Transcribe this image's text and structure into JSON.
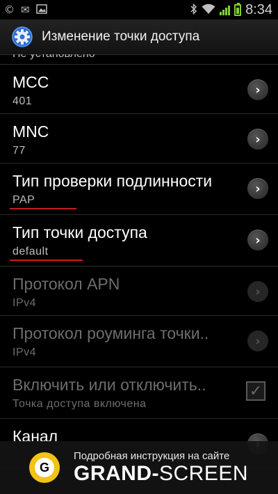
{
  "status_bar": {
    "time": "8:34",
    "left_icons": [
      "copyright-icon",
      "mail-icon",
      "image-icon"
    ],
    "right_icons": [
      "bluetooth-icon",
      "wifi-icon",
      "signal-icon",
      "battery-icon"
    ]
  },
  "action_bar": {
    "title": "Изменение точки доступа",
    "icon": "settings-gear-icon"
  },
  "list": {
    "partial_item_summary": "Не установлено",
    "items": [
      {
        "title": "MCC",
        "summary": "401",
        "enabled": true
      },
      {
        "title": "MNC",
        "summary": "77",
        "enabled": true
      },
      {
        "title": "Тип проверки подлинности",
        "summary": "PAP",
        "enabled": true
      },
      {
        "title": "Тип точки доступа",
        "summary": "default",
        "enabled": true
      },
      {
        "title": "Протокол APN",
        "summary": "IPv4",
        "enabled": false
      },
      {
        "title": "Протокол роуминга точки..",
        "summary": "IPv4",
        "enabled": false
      },
      {
        "title": "Включить или отключить..",
        "summary": "Точка доступа включена",
        "enabled": false,
        "checked": true
      },
      {
        "title": "Канал",
        "summary": "",
        "enabled": true
      }
    ]
  },
  "banner": {
    "logo_letter": "G",
    "line1": "Подробная инструкция на сайте",
    "brand_bold": "GRAND-",
    "brand_regular": "SCREEN"
  },
  "colors": {
    "background": "#000000",
    "accent_green": "#7fcf38",
    "annotation_red": "#c81d1d",
    "logo_yellow": "#f3c315",
    "disabled_text": "#6d6d6d"
  }
}
